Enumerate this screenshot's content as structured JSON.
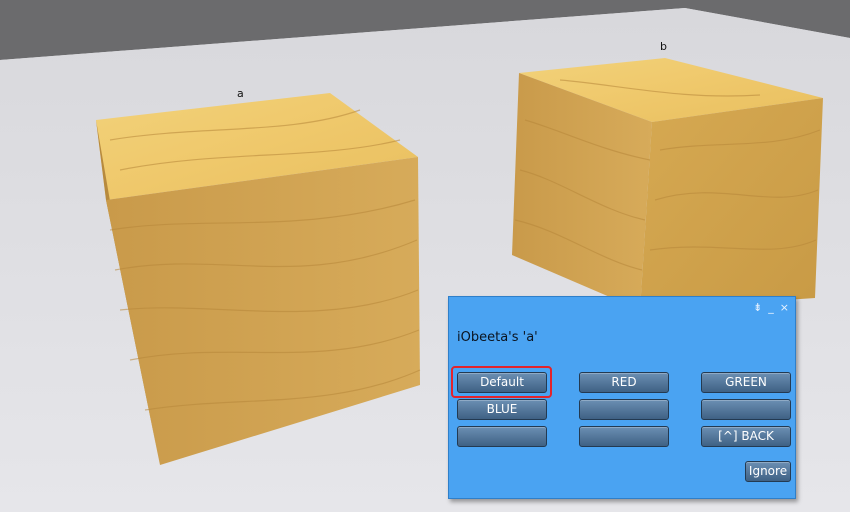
{
  "objects": {
    "cube_a_label": "a",
    "cube_b_label": "b"
  },
  "dialog": {
    "title": "iObeeta's 'a'",
    "controls": {
      "dock_icon": "⇟",
      "minimize_icon": "_",
      "close_icon": "×"
    },
    "buttons": [
      {
        "label": "Default",
        "highlighted": true
      },
      {
        "label": "RED"
      },
      {
        "label": "GREEN"
      },
      {
        "label": "BLUE"
      },
      {
        "label": ""
      },
      {
        "label": ""
      },
      {
        "label": ""
      },
      {
        "label": ""
      },
      {
        "label": "[^] BACK"
      }
    ],
    "ignore_label": "Ignore"
  },
  "colors": {
    "dialog_bg": "#4aa3f2",
    "button_top": "#6b8fb3",
    "button_bottom": "#3f6184",
    "highlight": "#e3232b"
  }
}
